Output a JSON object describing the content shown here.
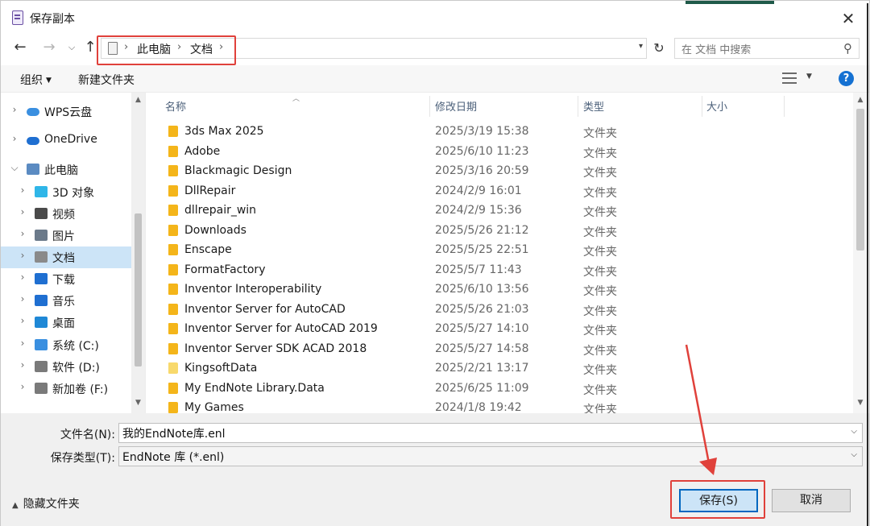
{
  "window": {
    "title": "保存副本"
  },
  "address": {
    "crumbs": [
      "此电脑",
      "文档"
    ],
    "search_placeholder": "在 文档 中搜索"
  },
  "toolbar": {
    "organize": "组织",
    "new_folder": "新建文件夹",
    "help": "?"
  },
  "nav_items": [
    {
      "label": "WPS云盘",
      "icon": "cloud-icon",
      "color": "#3a8fe0"
    },
    {
      "label": "OneDrive",
      "icon": "onedrive-icon",
      "color": "#1f6fd1"
    },
    {
      "label": "此电脑",
      "icon": "computer-icon",
      "color": "#5b8bc2"
    },
    {
      "label": "3D 对象",
      "icon": "cube-icon",
      "color": "#2fb6e8"
    },
    {
      "label": "视频",
      "icon": "film-icon",
      "color": "#4a4a4a"
    },
    {
      "label": "图片",
      "icon": "image-icon",
      "color": "#6b7a8a"
    },
    {
      "label": "文档",
      "icon": "document-icon",
      "color": "#8a8a8a"
    },
    {
      "label": "下载",
      "icon": "download-icon",
      "color": "#1f6fd1"
    },
    {
      "label": "音乐",
      "icon": "music-icon",
      "color": "#1f6fd1"
    },
    {
      "label": "桌面",
      "icon": "desktop-icon",
      "color": "#1f88d6"
    },
    {
      "label": "系统 (C:)",
      "icon": "drive-c-icon",
      "color": "#3a8fe0"
    },
    {
      "label": "软件 (D:)",
      "icon": "drive-d-icon",
      "color": "#7a7a7a"
    },
    {
      "label": "新加卷 (F:)",
      "icon": "drive-f-icon",
      "color": "#7a7a7a"
    }
  ],
  "columns": {
    "name": "名称",
    "date": "修改日期",
    "type": "类型",
    "size": "大小"
  },
  "files": [
    {
      "name": "3ds Max 2025",
      "date": "2025/3/19 15:38",
      "type": "文件夹"
    },
    {
      "name": "Adobe",
      "date": "2025/6/10 11:23",
      "type": "文件夹"
    },
    {
      "name": "Blackmagic Design",
      "date": "2025/3/16 20:59",
      "type": "文件夹"
    },
    {
      "name": "DllRepair",
      "date": "2024/2/9 16:01",
      "type": "文件夹"
    },
    {
      "name": "dllrepair_win",
      "date": "2024/2/9 15:36",
      "type": "文件夹"
    },
    {
      "name": "Downloads",
      "date": "2025/5/26 21:12",
      "type": "文件夹"
    },
    {
      "name": "Enscape",
      "date": "2025/5/25 22:51",
      "type": "文件夹"
    },
    {
      "name": "FormatFactory",
      "date": "2025/5/7 11:43",
      "type": "文件夹"
    },
    {
      "name": "Inventor Interoperability",
      "date": "2025/6/10 13:56",
      "type": "文件夹"
    },
    {
      "name": "Inventor Server for AutoCAD",
      "date": "2025/5/26 21:03",
      "type": "文件夹"
    },
    {
      "name": "Inventor Server for AutoCAD 2019",
      "date": "2025/5/27 14:10",
      "type": "文件夹"
    },
    {
      "name": "Inventor Server SDK ACAD 2018",
      "date": "2025/5/27 14:58",
      "type": "文件夹"
    },
    {
      "name": "KingsoftData",
      "date": "2025/2/21 13:17",
      "type": "文件夹"
    },
    {
      "name": "My EndNote Library.Data",
      "date": "2025/6/25 11:09",
      "type": "文件夹"
    },
    {
      "name": "My Games",
      "date": "2024/1/8 19:42",
      "type": "文件夹"
    }
  ],
  "form": {
    "filename_label": "文件名(N):",
    "filename_value": "我的EndNote库.enl",
    "filetype_label": "保存类型(T):",
    "filetype_value": "EndNote 库 (*.enl)"
  },
  "footer": {
    "hide_folders": "隐藏文件夹",
    "save": "保存(S)",
    "cancel": "取消"
  },
  "colors": {
    "highlight": "#e0413b",
    "folder": "#f4b51a",
    "selected": "#cce4f7",
    "accent": "#0067c0"
  }
}
